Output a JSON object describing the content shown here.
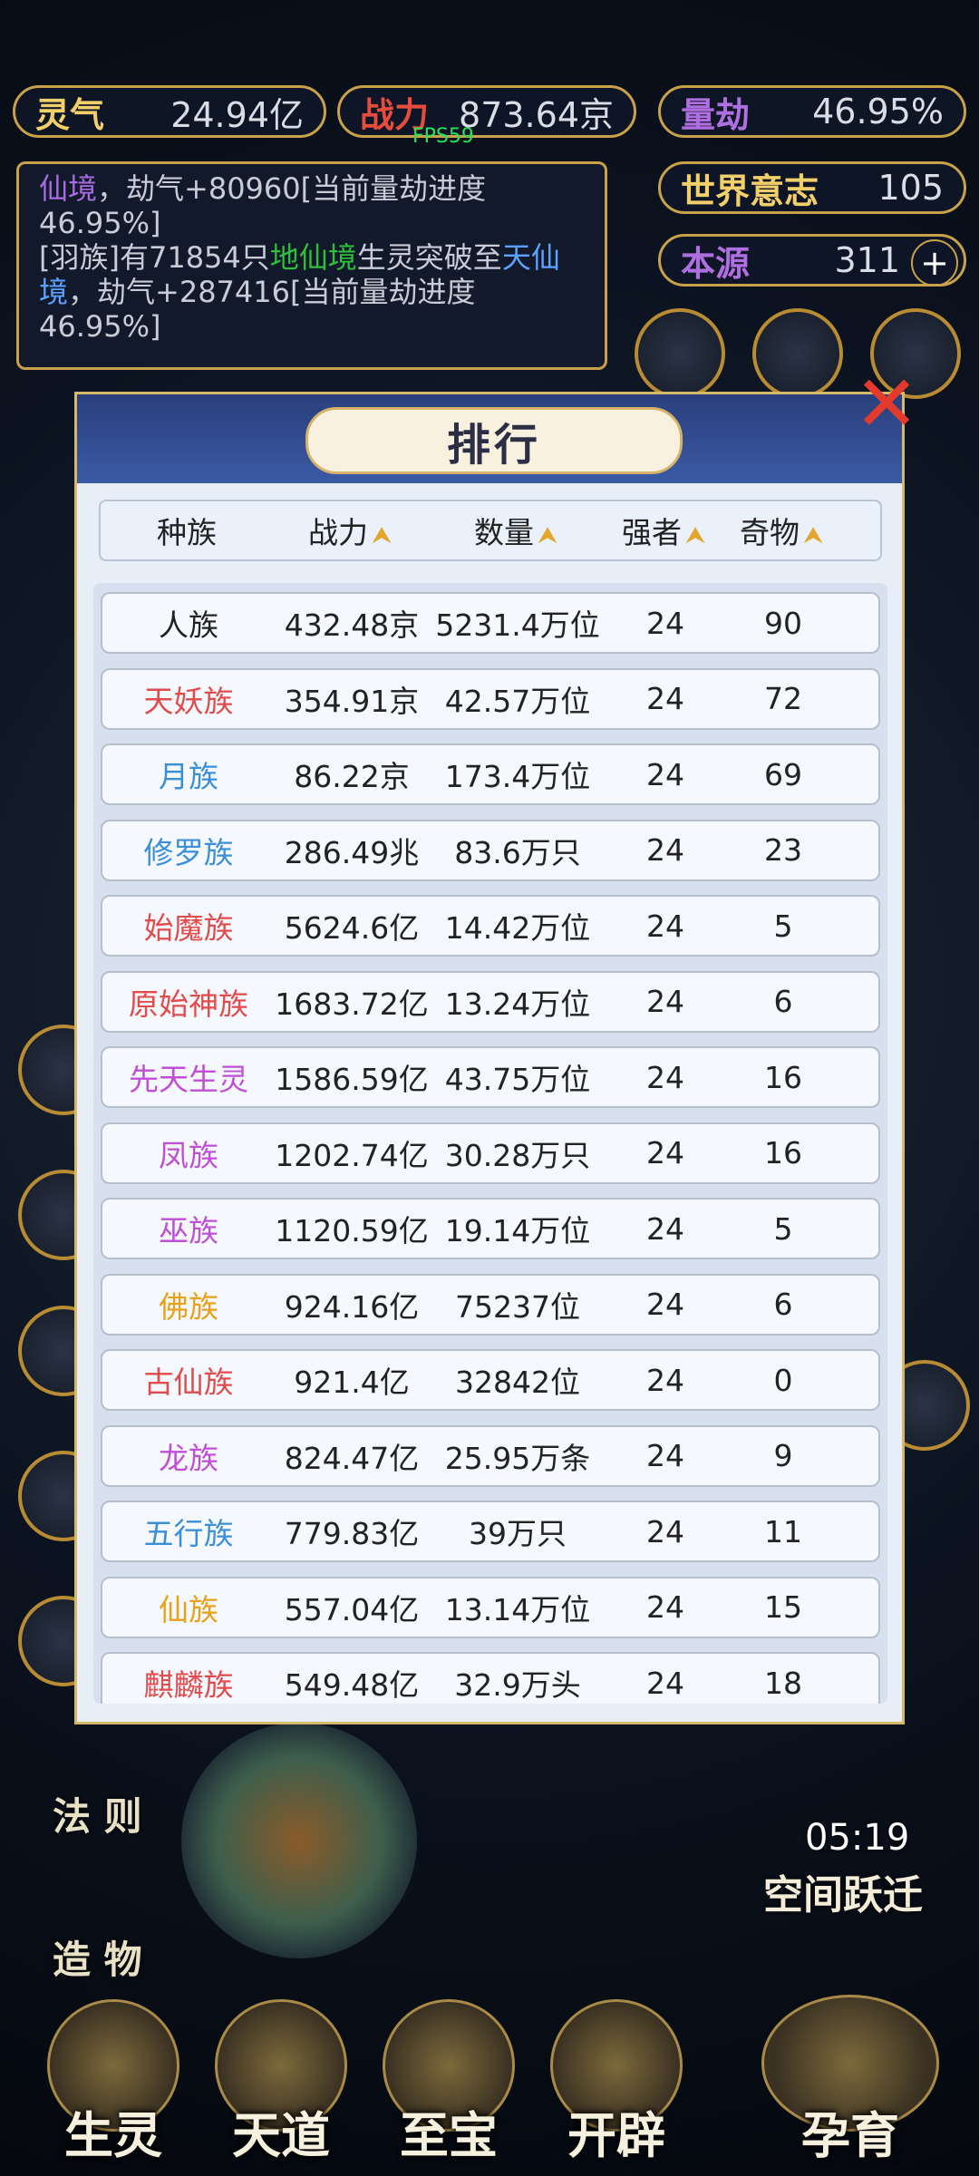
{
  "top_bar": {
    "lingqi": {
      "label": "灵气",
      "value": "24.94亿"
    },
    "zhanli": {
      "label": "战力",
      "value": "873.64京"
    },
    "liangjie": {
      "label": "量劫",
      "value": "46.95%"
    },
    "world_will": {
      "label": "世界意志",
      "value": "105"
    },
    "source": {
      "label": "本源",
      "value": "311"
    }
  },
  "fps": "FPS59",
  "log": {
    "line1_a": "仙境",
    "line1_b": "，劫气+80960[当前量劫进度",
    "line2": "46.95%]",
    "line3_a": "[羽族]有71854只",
    "line3_b": "地仙境",
    "line3_c": "生灵突破至",
    "line3_d": "天仙",
    "line4_a": "境",
    "line4_b": "，劫气+287416[当前量劫进度",
    "line5": "46.95%]"
  },
  "dialog": {
    "title": "排行",
    "headers": [
      "种族",
      "战力",
      "数量",
      "强者",
      "奇物"
    ],
    "rows": [
      {
        "name": "人族",
        "color": "#222222",
        "power": "432.48京",
        "count": "5231.4万位",
        "strong": "24",
        "treasure": "90"
      },
      {
        "name": "天妖族",
        "color": "#e24b4b",
        "power": "354.91京",
        "count": "42.57万位",
        "strong": "24",
        "treasure": "72"
      },
      {
        "name": "月族",
        "color": "#3a8fd8",
        "power": "86.22京",
        "count": "173.4万位",
        "strong": "24",
        "treasure": "69"
      },
      {
        "name": "修罗族",
        "color": "#3a8fd8",
        "power": "286.49兆",
        "count": "83.6万只",
        "strong": "24",
        "treasure": "23"
      },
      {
        "name": "始魔族",
        "color": "#e24b4b",
        "power": "5624.6亿",
        "count": "14.42万位",
        "strong": "24",
        "treasure": "5"
      },
      {
        "name": "原始神族",
        "color": "#e24b4b",
        "power": "1683.72亿",
        "count": "13.24万位",
        "strong": "24",
        "treasure": "6"
      },
      {
        "name": "先天生灵",
        "color": "#c04fd6",
        "power": "1586.59亿",
        "count": "43.75万位",
        "strong": "24",
        "treasure": "16"
      },
      {
        "name": "凤族",
        "color": "#c04fd6",
        "power": "1202.74亿",
        "count": "30.28万只",
        "strong": "24",
        "treasure": "16"
      },
      {
        "name": "巫族",
        "color": "#c04fd6",
        "power": "1120.59亿",
        "count": "19.14万位",
        "strong": "24",
        "treasure": "5"
      },
      {
        "name": "佛族",
        "color": "#e8a21a",
        "power": "924.16亿",
        "count": "75237位",
        "strong": "24",
        "treasure": "6"
      },
      {
        "name": "古仙族",
        "color": "#e24b4b",
        "power": "921.4亿",
        "count": "32842位",
        "strong": "24",
        "treasure": "0"
      },
      {
        "name": "龙族",
        "color": "#c04fd6",
        "power": "824.47亿",
        "count": "25.95万条",
        "strong": "24",
        "treasure": "9"
      },
      {
        "name": "五行族",
        "color": "#3a8fd8",
        "power": "779.83亿",
        "count": "39万只",
        "strong": "24",
        "treasure": "11"
      },
      {
        "name": "仙族",
        "color": "#e8a21a",
        "power": "557.04亿",
        "count": "13.14万位",
        "strong": "24",
        "treasure": "15"
      },
      {
        "name": "麒麟族",
        "color": "#e24b4b",
        "power": "549.48亿",
        "count": "32.9万头",
        "strong": "24",
        "treasure": "18"
      }
    ]
  },
  "side_left": {
    "fa_ze": "法 则",
    "zao_wu": "造 物"
  },
  "space_jump": {
    "timer": "05:19",
    "label": "空间跃迁"
  },
  "bottom_nav": [
    "生灵",
    "天道",
    "至宝",
    "开辟",
    "孕育"
  ]
}
